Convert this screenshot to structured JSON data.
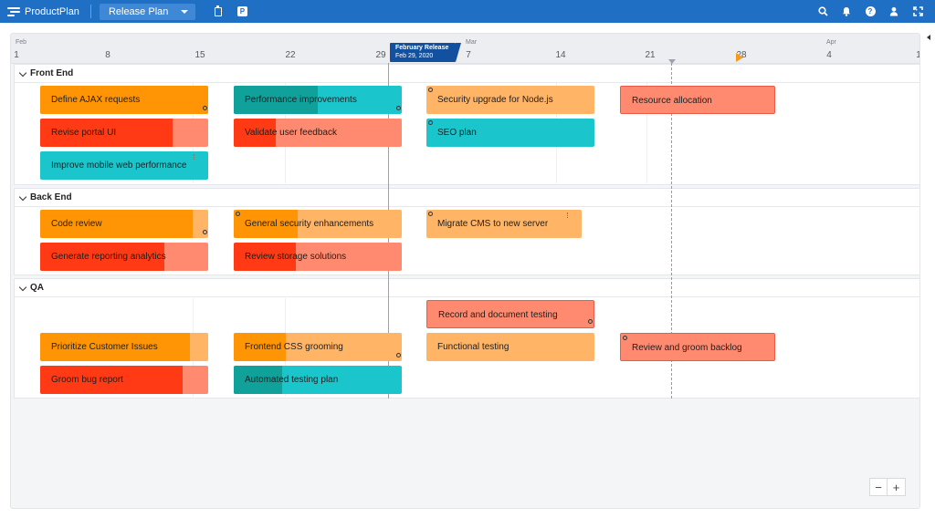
{
  "app": {
    "logo_text": "ProductPlan",
    "plan_select": "Release Plan"
  },
  "toolbar_icons": [
    "clipboard-icon",
    "p-icon",
    "search-icon",
    "bell-icon",
    "help-icon",
    "user-icon",
    "fullscreen-icon"
  ],
  "timeline": {
    "months": [
      "Feb",
      "Mar",
      "Apr"
    ],
    "days": [
      "1",
      "8",
      "15",
      "22",
      "29",
      "7",
      "14",
      "21",
      "28",
      "4",
      "1"
    ]
  },
  "milestone": {
    "name": "February Release",
    "date": "Feb 29, 2020"
  },
  "colors": {
    "topbar": "#1f6fc5",
    "orange": "#ff9505",
    "red": "#ff3a14",
    "teal": "#1ac6cb",
    "salmon": "#ff8a6f",
    "milestone": "#12519f"
  },
  "lanes": [
    {
      "title": "Front End",
      "bars": [
        {
          "label": "Define AJAX requests",
          "color": "orange",
          "progress": 1.0
        },
        {
          "label": "Performance improvements",
          "color": "teal",
          "progress": 0.5
        },
        {
          "label": "Security upgrade for Node.js",
          "color": "orange",
          "progress": 0
        },
        {
          "label": "Resource allocation",
          "color": "salmon",
          "progress": 0
        },
        {
          "label": "Revise portal UI",
          "color": "red",
          "progress": 0.79
        },
        {
          "label": "Validate user feedback",
          "color": "red",
          "progress": 0.25
        },
        {
          "label": "SEO plan",
          "color": "teal",
          "progress": 0
        },
        {
          "label": "Improve mobile web performance",
          "color": "teal",
          "progress": 0
        }
      ]
    },
    {
      "title": "Back End",
      "bars": [
        {
          "label": "Code review",
          "color": "orange",
          "progress": 0.91
        },
        {
          "label": "General security enhancements",
          "color": "orange",
          "progress": 0.38
        },
        {
          "label": "Migrate CMS to new server",
          "color": "orange",
          "progress": 0
        },
        {
          "label": "Generate reporting analytics",
          "color": "red",
          "progress": 0.74
        },
        {
          "label": "Review storage solutions",
          "color": "red",
          "progress": 0.37
        }
      ]
    },
    {
      "title": "QA",
      "bars": [
        {
          "label": "Record and document testing",
          "color": "salmon",
          "progress": 0
        },
        {
          "label": "Prioritize Customer Issues",
          "color": "orange",
          "progress": 0.89
        },
        {
          "label": "Frontend CSS grooming",
          "color": "orange",
          "progress": 0.31
        },
        {
          "label": "Functional testing",
          "color": "orange",
          "progress": 0
        },
        {
          "label": "Review and groom backlog",
          "color": "salmon",
          "progress": 0
        },
        {
          "label": "Groom bug report",
          "color": "red",
          "progress": 0.85
        },
        {
          "label": "Automated testing plan",
          "color": "teal",
          "progress": 0.29
        }
      ]
    }
  ],
  "zoom": {
    "minus": "−",
    "plus": "+"
  }
}
